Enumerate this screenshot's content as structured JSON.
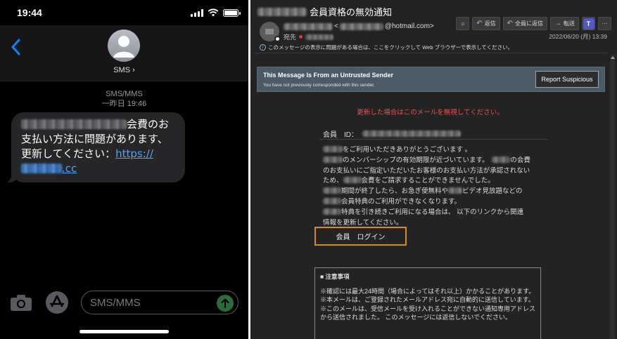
{
  "phone": {
    "time": "19:44",
    "contact_name": "SMS",
    "contact_chevron": "›",
    "meta_service": "SMS/MMS",
    "meta_time": "一昨日 19:46",
    "message": {
      "text_1": "会費のお支払い方法に問題があります、更新してください：",
      "link_visible": "https://",
      "link_tail": ".cc"
    },
    "input_placeholder": "SMS/MMS"
  },
  "mail": {
    "subject": "会員資格の無効通知",
    "from_tail": "@hotmail.com>",
    "from_head": "<",
    "to_label": "宛先",
    "date": "2022/06/20 (月) 13:39",
    "toolbar": {
      "reply": "返信",
      "reply_all": "全員に返信",
      "forward": "転送",
      "more": "···"
    },
    "info_bar": "このメッセージの表示に問題がある場合は、ここをクリックして Web ブラウザーで表示してください。",
    "warning": {
      "title": "This Message Is From an Untrusted Sender",
      "subtitle": "You have not previously corresponded with this sender.",
      "report_button": "Report Suspicious"
    },
    "red_note": "更新した場合はこのメールを無視してください。",
    "member_id_label": "会員　ID：",
    "body_lines": [
      {
        "pre": "",
        "text": "をご利用いただきありがとうございます 。"
      },
      {
        "pre": "",
        "text": "のメンバーシップの有効期限が近づいています。"
      },
      {
        "pre": "",
        "text": "のお支払いにご指定いただいたお客様のお支払い方法が承認されない"
      },
      {
        "pre": "",
        "text": "会費をご請求することができませんでした。"
      },
      {
        "pre": "",
        "text": "期間が終了したら、お急ぎ便無料や"
      },
      {
        "pre": "",
        "text": "会員特典のご利用ができなくなります。"
      },
      {
        "pre": "",
        "text": "特典を引き続きご利用になる場合は、 以下のリンクから関連"
      },
      {
        "pre": "",
        "text": "情報を更新してください。"
      }
    ],
    "body_fragments": {
      "l1b": "の会費",
      "l3a": "ため、",
      "l5b": "ビデオ見放題などの"
    },
    "login_button": "会員　ログイン",
    "notice": {
      "title": "■ 注意事項",
      "lines": [
        "※確認には最大24時間（場合によってはそれ以上）かかることがあります。",
        "※本メールは、ご登録されたメールアドレス宛に自動的に送信しています。",
        "※このメールは、受信メールを受け入れることができない通知専用アドレスから送信されました。 このメッセージには返信しないでください。"
      ]
    }
  }
}
